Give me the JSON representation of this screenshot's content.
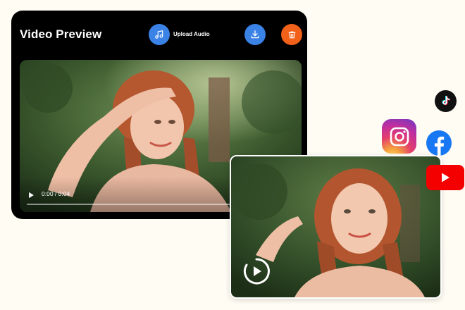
{
  "editor": {
    "title": "Video Preview",
    "upload_audio_label": "Upload Audio",
    "icons": {
      "upload": "music-note-icon",
      "download": "download-icon",
      "delete": "trash-icon"
    },
    "colors": {
      "accent_blue": "#3b82e6",
      "delete_orange": "#f2611a",
      "card_background": "#000000"
    }
  },
  "player": {
    "time": "0:00 / 0:04",
    "progress": 0,
    "icons": {
      "play": "play-icon"
    }
  },
  "preview": {
    "icons": {
      "play": "play-circle-icon"
    }
  },
  "social": {
    "items": [
      {
        "name": "tiktok-icon",
        "color": "#111111"
      },
      {
        "name": "instagram-icon",
        "color": "#e33e6b"
      },
      {
        "name": "facebook-icon",
        "color": "#1877f2"
      },
      {
        "name": "youtube-icon",
        "color": "#f40000"
      }
    ]
  },
  "page": {
    "background": "#fffcf4"
  }
}
